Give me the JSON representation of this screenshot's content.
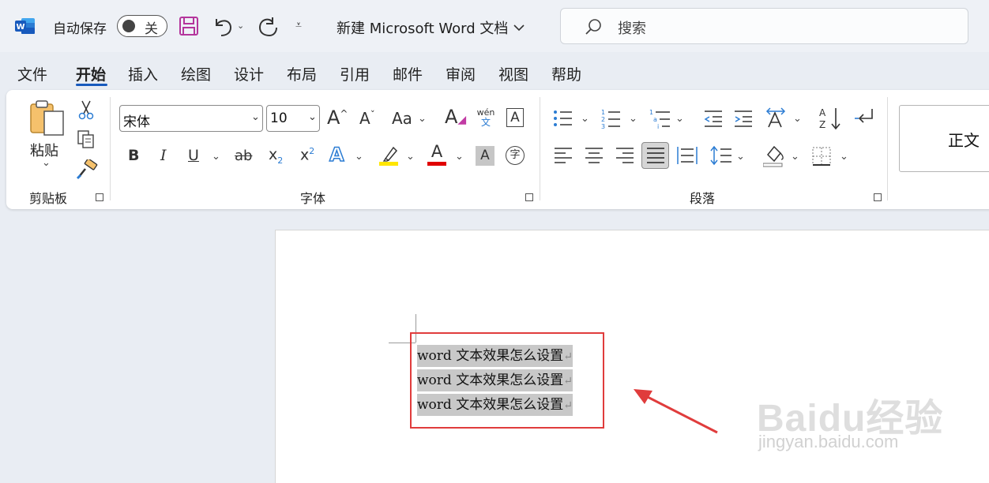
{
  "titlebar": {
    "app_icon": "word-app-icon",
    "autosave_label": "自动保存",
    "autosave_state": "关",
    "doc_title": "新建 Microsoft Word 文档",
    "search_placeholder": "搜索"
  },
  "menu": {
    "tabs": [
      "文件",
      "开始",
      "插入",
      "绘图",
      "设计",
      "布局",
      "引用",
      "邮件",
      "审阅",
      "视图",
      "帮助"
    ],
    "active": "开始"
  },
  "ribbon": {
    "clipboard": {
      "paste_label": "粘贴",
      "group_label": "剪贴板"
    },
    "font": {
      "font_name": "宋体",
      "font_size": "10",
      "group_label": "字体",
      "phonetic_top": "wén",
      "phonetic_bottom": "文",
      "enclose_char": "字"
    },
    "paragraph": {
      "group_label": "段落"
    },
    "styles": {
      "normal_label": "正文"
    }
  },
  "document": {
    "lines": [
      "word 文本效果怎么设置",
      "word 文本效果怎么设置",
      "word 文本效果怎么设置"
    ]
  },
  "watermark": {
    "logo": "Baidu经验",
    "url": "jingyan.baidu.com"
  },
  "colors": {
    "accent": "#185abd",
    "highlight_frame": "#e03c3c",
    "arrow": "#e03c3c",
    "word_blue": "#185abd",
    "highlight_yellow": "#ffe600",
    "font_red": "#e00000"
  }
}
